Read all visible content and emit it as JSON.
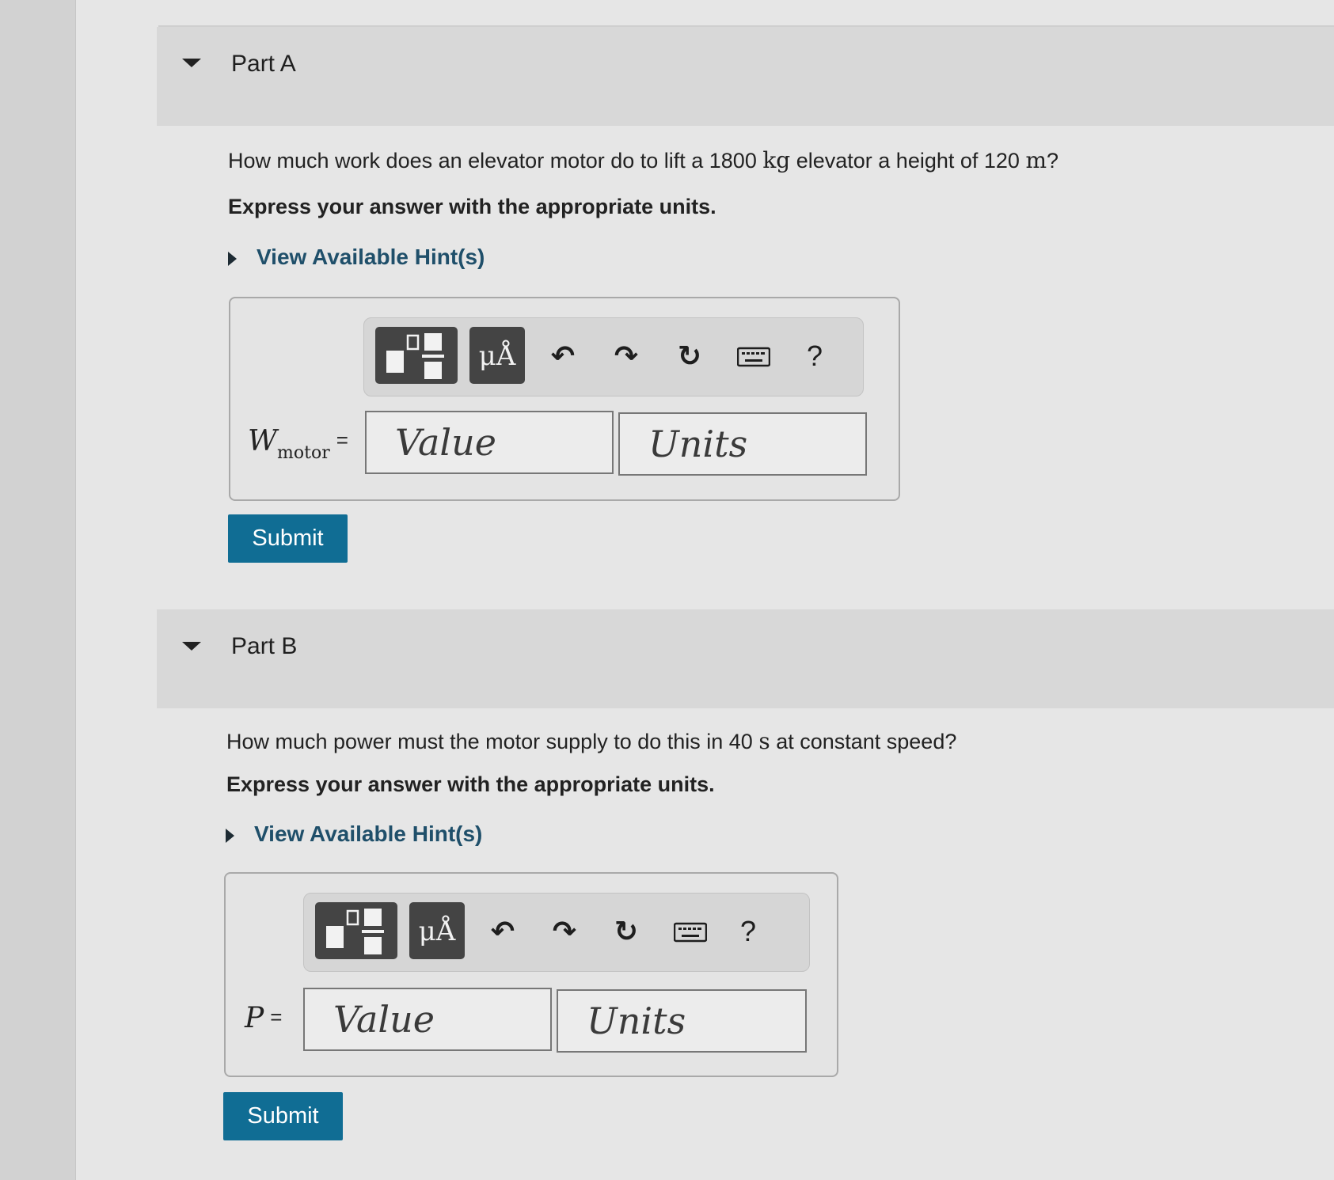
{
  "partA": {
    "title": "Part A",
    "question_prefix": "How much work does an elevator motor do to lift a 1800 ",
    "question_unit1": "kg",
    "question_middle": " elevator a height of 120 ",
    "question_unit2": "m",
    "question_suffix": "?",
    "instruction": "Express your answer with the appropriate units.",
    "hint_label": "View Available Hint(s)",
    "toolbar": {
      "units_label": "μÅ",
      "undo_glyph": "↶",
      "redo_glyph": "↷",
      "reset_glyph": "↻",
      "help_label": "?"
    },
    "variable": {
      "symbol": "W",
      "subscript": "motor",
      "equals": "="
    },
    "value_placeholder": "Value",
    "units_placeholder": "Units",
    "submit_label": "Submit"
  },
  "partB": {
    "title": "Part B",
    "question_prefix": "How much power must the motor supply to do this in 40 ",
    "question_unit": "s",
    "question_suffix": " at constant speed?",
    "instruction": "Express your answer with the appropriate units.",
    "hint_label": "View Available Hint(s)",
    "toolbar": {
      "units_label": "μÅ",
      "undo_glyph": "↶",
      "redo_glyph": "↷",
      "reset_glyph": "↻",
      "help_label": "?"
    },
    "variable": {
      "symbol": "P",
      "equals": "="
    },
    "value_placeholder": "Value",
    "units_placeholder": "Units",
    "submit_label": "Submit"
  },
  "icons": {
    "caret": "caret-down-icon",
    "hint": "caret-right-icon",
    "templates": "templates-icon",
    "units": "units-symbol-icon",
    "undo": "undo-icon",
    "redo": "redo-icon",
    "reset": "reset-icon",
    "keyboard": "keyboard-icon",
    "help": "help-icon"
  },
  "colors": {
    "submit_bg": "#106d94",
    "hint_text": "#1f4f6a",
    "toolbar_button": "#444444",
    "header_bg": "#d8d8d8"
  }
}
